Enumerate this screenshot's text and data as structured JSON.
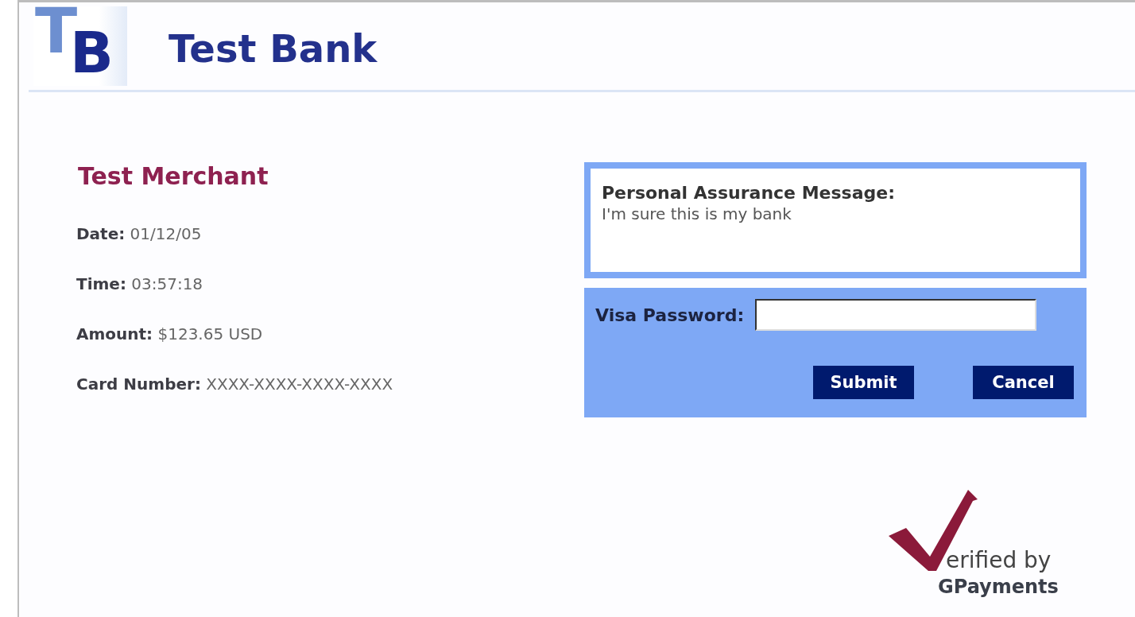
{
  "header": {
    "logo_letters": [
      "T",
      "B"
    ],
    "title": "Test Bank"
  },
  "merchant": {
    "name": "Test Merchant",
    "fields": [
      {
        "label": "Date:",
        "value": "01/12/05"
      },
      {
        "label": "Time:",
        "value": "03:57:18"
      },
      {
        "label": "Amount:",
        "value": "$123.65 USD"
      },
      {
        "label": "Card Number:",
        "value": "XXXX-XXXX-XXXX-XXXX"
      }
    ]
  },
  "assurance": {
    "title": "Personal Assurance Message:",
    "message": "I'm sure this is my bank"
  },
  "password_form": {
    "label": "Visa Password:",
    "buttons": [
      "Submit",
      "Cancel"
    ]
  },
  "verified_badge": {
    "line_1": "erified by",
    "line_2": "GPayments"
  }
}
